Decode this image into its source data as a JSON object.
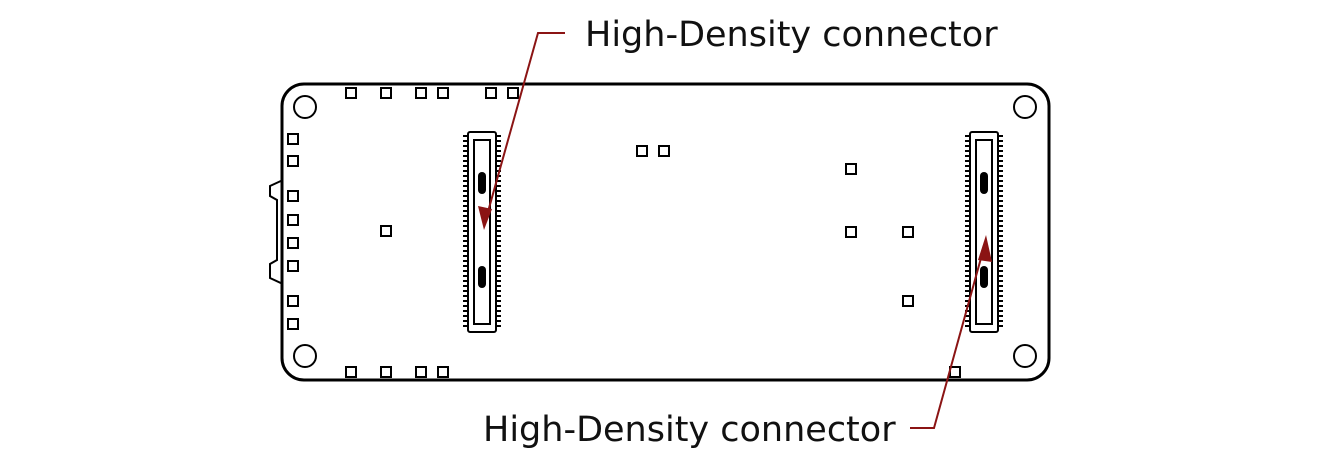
{
  "labels": {
    "top_connector": "High-Density connector",
    "bottom_connector": "High-Density connector"
  },
  "colors": {
    "leader": "#8b1414",
    "outline": "#000000",
    "background": "#ffffff"
  }
}
